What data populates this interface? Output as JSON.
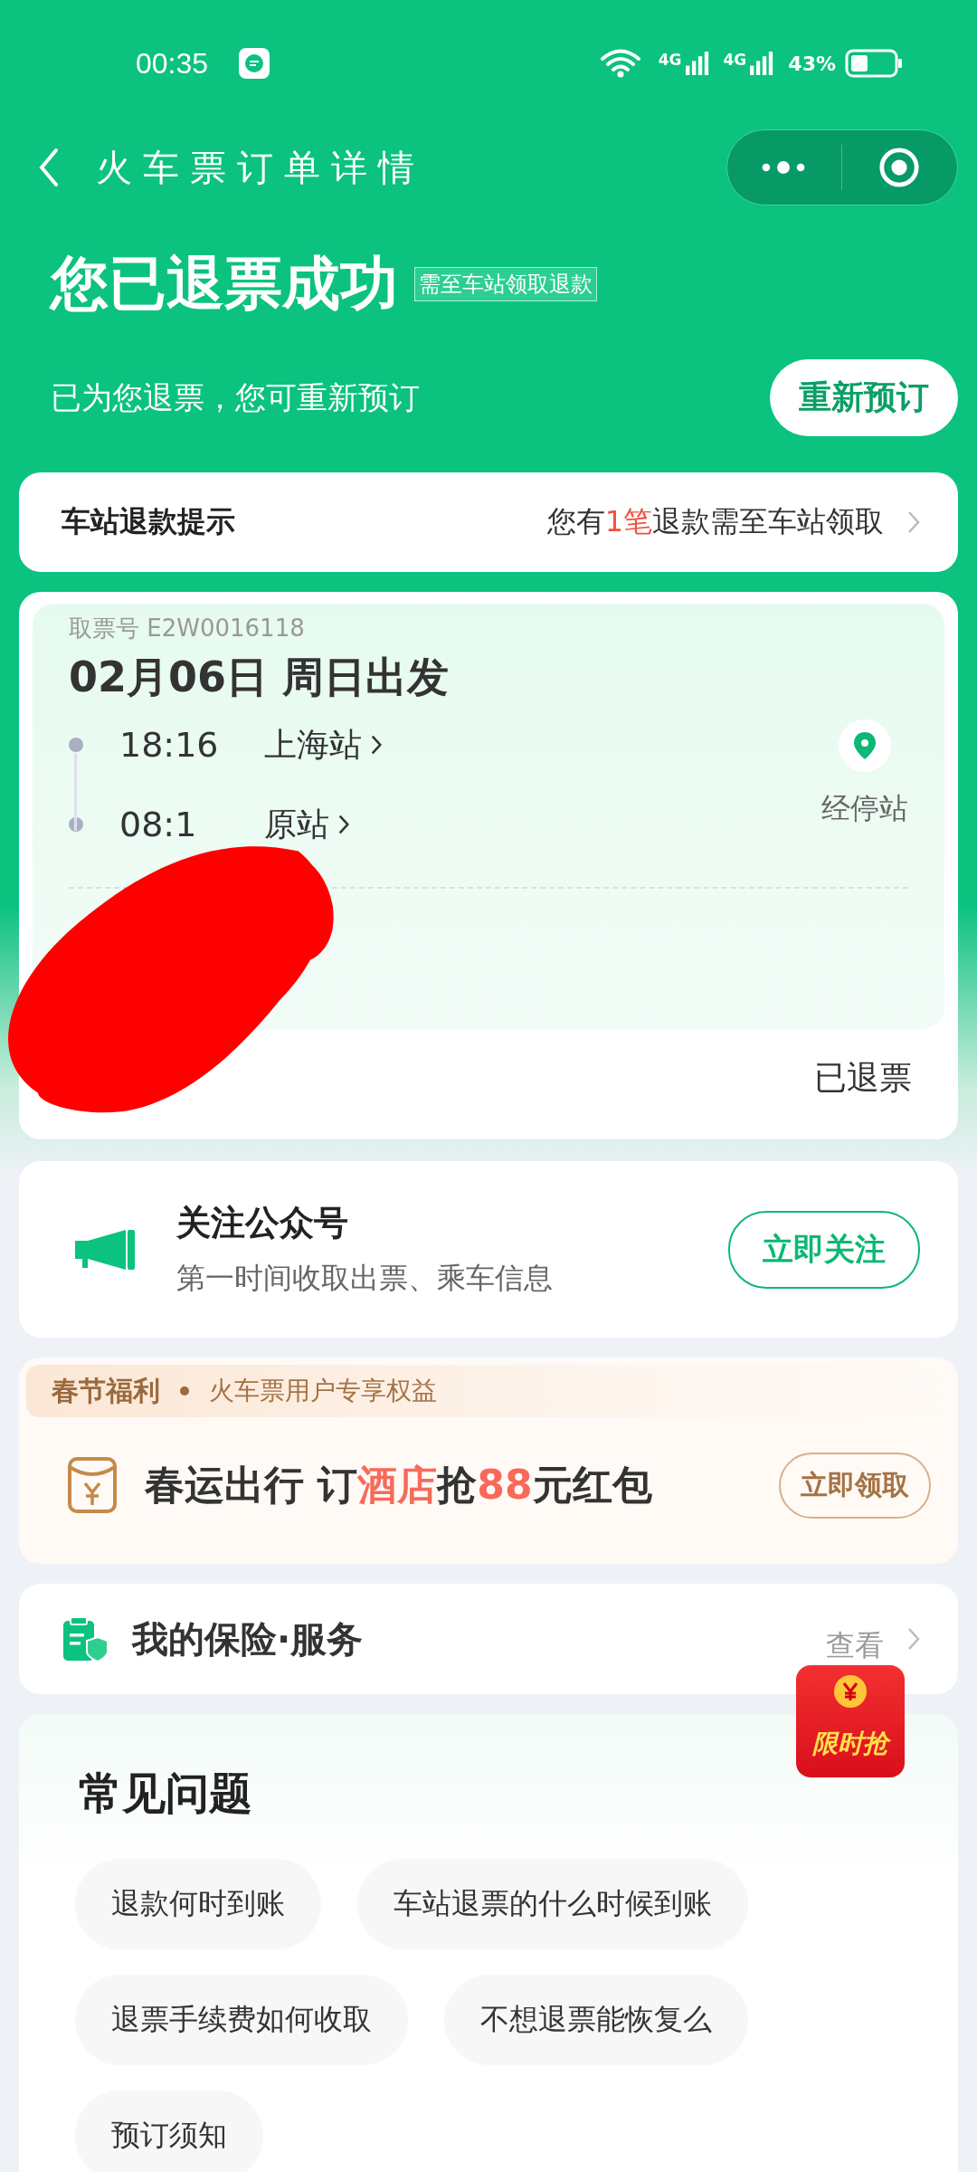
{
  "status_bar": {
    "time": "00:35",
    "networks": [
      "4G",
      "4G"
    ],
    "battery": "43%"
  },
  "nav": {
    "title": "火车票订单详情"
  },
  "header": {
    "title": "您已退票成功",
    "tag": "需至车站领取退款",
    "subtitle": "已为您退票，您可重新预订",
    "button": "重新预订"
  },
  "notice": {
    "label": "车站退款提示",
    "message": [
      {
        "text": "您有",
        "highlight": false
      },
      {
        "text": "1笔",
        "highlight": true
      },
      {
        "text": "退款需至车站领取",
        "highlight": false
      }
    ]
  },
  "ticket": {
    "pickup_code": "取票号 E2W0016118",
    "date": "02月06日 周日出发",
    "stops": [
      {
        "time": "18:16",
        "station": "上海站"
      },
      {
        "time": "08:1",
        "station": "原站"
      }
    ],
    "stops_link": "经停站",
    "status": "已退票"
  },
  "follow": {
    "title": "关注公众号",
    "subtitle": "第一时间收取出票、乘车信息",
    "button": "立即关注"
  },
  "promo": {
    "tag": "春节福利",
    "subtitle": "火车票用户专享权益",
    "title": [
      {
        "text": "春运出行 订",
        "highlight": false
      },
      {
        "text": "酒店",
        "highlight": true
      },
      {
        "text": "抢",
        "highlight": false
      },
      {
        "text": "88",
        "highlight": true
      },
      {
        "text": "元红包",
        "highlight": false
      }
    ],
    "button": "立即领取"
  },
  "insurance": {
    "title": "我的保险·服务",
    "link": "查看"
  },
  "float_badge": {
    "label": "限时抢"
  },
  "faq": {
    "title": "常见问题",
    "items": [
      "退款何时到账",
      "车站退票的什么时候到账",
      "退票手续费如何收取",
      "不想退票能恢复么",
      "预订须知"
    ]
  }
}
